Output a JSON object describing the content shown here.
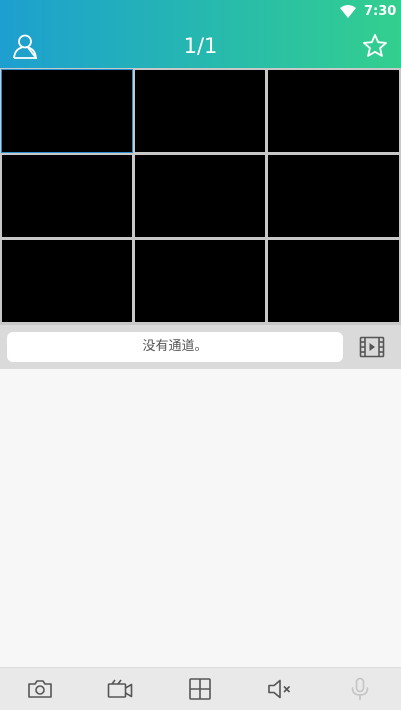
{
  "status_bar": {
    "time": "7:30"
  },
  "header": {
    "page_indicator": "1/1"
  },
  "channel_bar": {
    "status_text": "没有通道。"
  },
  "colors": {
    "header_start": "#1d9fd0",
    "header_end": "#33cf8e",
    "selection": "#2a8fd0"
  },
  "icons": {
    "header_left": "user-icon",
    "header_right": "star-icon",
    "channel_bar_right": "video-playback-icon",
    "toolbar": [
      "camera-icon",
      "video-camera-icon",
      "grid-layout-icon",
      "mute-icon",
      "microphone-icon"
    ]
  }
}
